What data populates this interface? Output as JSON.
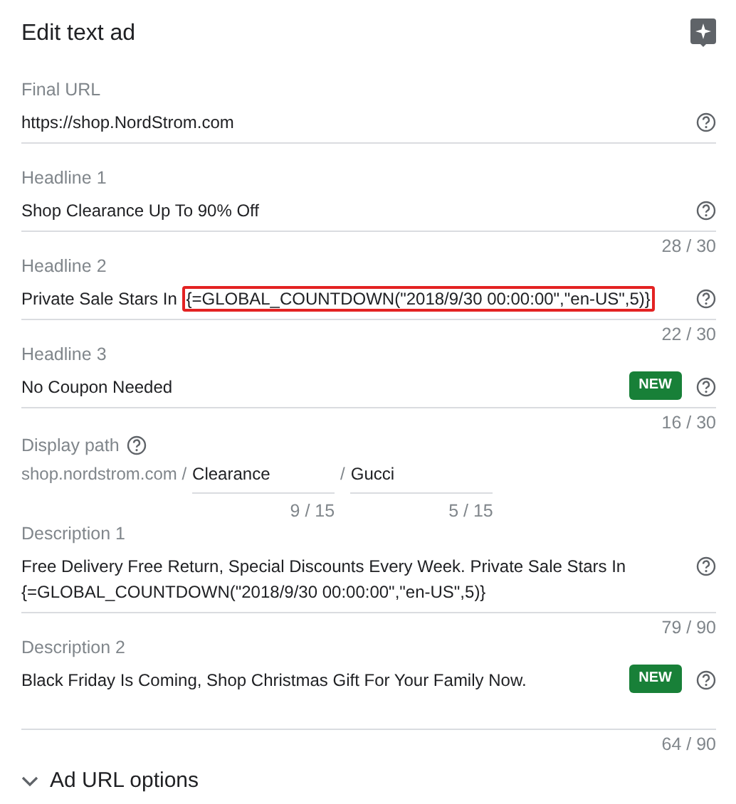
{
  "title": "Edit text ad",
  "fields": [
    {
      "kind": "text",
      "label": "Final URL",
      "value": "https://shop.NordStrom.com",
      "is_new": false
    },
    {
      "kind": "text",
      "label": "Headline 1",
      "value": "Shop Clearance Up To 90% Off",
      "is_new": false,
      "counter": "28 / 30"
    },
    {
      "kind": "text",
      "label": "Headline 2",
      "value": "Private Sale Stars In",
      "highlighted": "{=GLOBAL_COUNTDOWN(\"2018/9/30 00:00:00\",\"en-US\",5)}",
      "is_new": false,
      "counter": "22 / 30"
    },
    {
      "kind": "text",
      "label": "Headline 3",
      "value": "No Coupon Needed",
      "is_new": true,
      "badge": "NEW",
      "counter": "16 / 30"
    },
    {
      "kind": "path",
      "label": "Display path",
      "domain": "shop.nordstrom.com /",
      "separator": "/",
      "paths": [
        {
          "value": "Clearance",
          "counter": "9 / 15"
        },
        {
          "value": "Gucci",
          "counter": "5 / 15"
        }
      ]
    },
    {
      "kind": "text",
      "label": "Description 1",
      "value": "Free Delivery Free Return, Special Discounts Every Week. Private Sale Stars In {=GLOBAL_COUNTDOWN(\"2018/9/30 00:00:00\",\"en-US\",5)}",
      "is_new": false,
      "counter": "79 / 90"
    },
    {
      "kind": "text",
      "label": "Description 2",
      "value": "Black Friday Is Coming, Shop Christmas Gift For Your Family Now.",
      "is_new": true,
      "badge": "NEW",
      "counter": "64 / 90"
    }
  ],
  "options": {
    "label": "Ad URL options",
    "expanded": false
  }
}
